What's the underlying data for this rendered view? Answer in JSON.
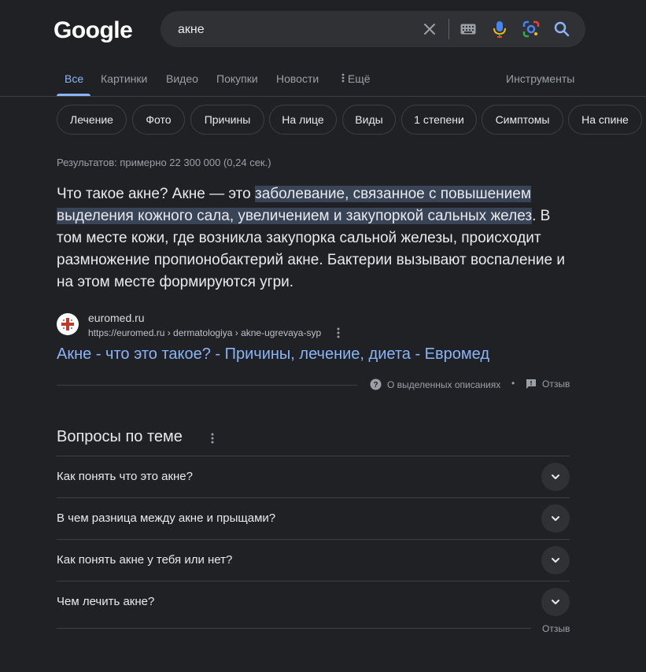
{
  "logo": "Google",
  "search": {
    "query": "акне",
    "icons": [
      "clear-icon",
      "keyboard-icon",
      "mic-icon",
      "lens-icon",
      "search-icon"
    ]
  },
  "tabs": {
    "items": [
      {
        "label": "Все",
        "active": true
      },
      {
        "label": "Картинки"
      },
      {
        "label": "Видео"
      },
      {
        "label": "Покупки"
      },
      {
        "label": "Новости"
      },
      {
        "label": "Ещё"
      }
    ],
    "tools": "Инструменты"
  },
  "chips": [
    "Лечение",
    "Фото",
    "Причины",
    "На лице",
    "Виды",
    "1 степени",
    "Симптомы",
    "На спине"
  ],
  "stats": "Результатов: примерно 22 300 000 (0,24 сек.)",
  "snippet": {
    "before": "Что такое акне? Акне — это ",
    "highlight": "заболевание, связанное с повышением выделения кожного сала, увеличением и закупоркой сальных желез",
    "after": ". В том месте кожи, где возникла закупорка сальной железы, происходит размножение пропионобактерий акне. Бактерии вызывают воспаление и на этом месте формируются угри."
  },
  "result": {
    "site_name": "euromed.ru",
    "url": "https://euromed.ru › dermatologiya › akne-ugrevaya-syp",
    "title": "Акне - что это такое? - Причины, лечение, диета - Евромед"
  },
  "snippet_footer": {
    "about": "О выделенных описаниях",
    "dot": "•",
    "feedback": "Отзыв"
  },
  "paa": {
    "title": "Вопросы по теме",
    "questions": [
      "Как понять что это акне?",
      "В чем разница между акне и прыщами?",
      "Как понять акне у тебя или нет?",
      "Чем лечить акне?"
    ],
    "feedback": "Отзыв"
  },
  "colors": {
    "background": "#202124",
    "link": "#8ab4f8",
    "highlight": "#394457",
    "muted": "#9aa0a6"
  }
}
